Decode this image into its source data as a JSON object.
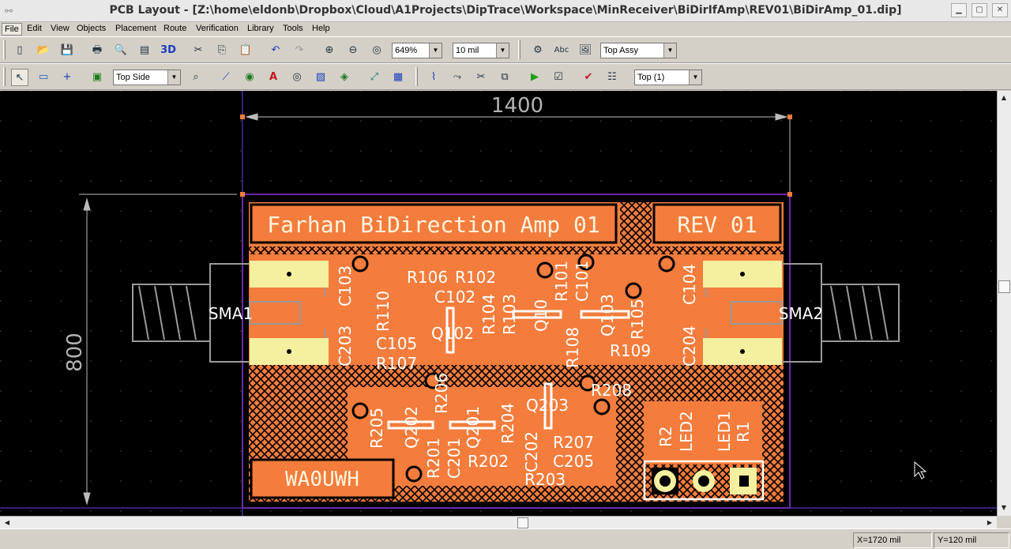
{
  "window": {
    "title": "PCB Layout - [Z:\\home\\eldonb\\Dropbox\\Cloud\\A1Projects\\DipTrace\\Workspace\\MinReceiver\\BiDirIfAmp\\REV01\\BiDirAmp_01.dip]",
    "buttons": [
      "▁",
      "▢",
      "✕"
    ]
  },
  "menu": [
    {
      "label": "File"
    },
    {
      "label": "Edit"
    },
    {
      "label": "View"
    },
    {
      "label": "Objects"
    },
    {
      "label": "Placement"
    },
    {
      "label": "Route"
    },
    {
      "label": "Verification"
    },
    {
      "label": "Library"
    },
    {
      "label": "Tools"
    },
    {
      "label": "Help"
    }
  ],
  "toolbar1": {
    "zoom": "649%",
    "grid": "10 mil",
    "view_mode": "Top Assy",
    "icons": [
      "new-icon",
      "open-icon",
      "save-icon",
      "print-icon",
      "print-preview-icon",
      "report-icon",
      "3d-view-icon",
      "cut-icon",
      "copy-icon",
      "paste-icon",
      "undo-icon",
      "redo-icon",
      "zoom-in-icon",
      "zoom-out-icon",
      "zoom-fit-icon",
      "layer-setup-icon",
      "spell-icon",
      "image-icon"
    ],
    "label_3d": "3D",
    "label_abc": "Abc"
  },
  "toolbar2": {
    "side": "Top Side",
    "layer": "Top (1)",
    "icons": [
      "select-icon",
      "ruler-icon",
      "origin-icon",
      "component-icon",
      "find-icon",
      "route-icon",
      "via-icon",
      "text-icon",
      "pad-icon",
      "copper-pour-icon",
      "shape-icon",
      "dimension-icon",
      "table-icon",
      "trace-icon",
      "auto-route-icon",
      "cut-trace-icon",
      "clone-icon",
      "run-icon",
      "check-icon",
      "drc-icon",
      "drc-setup-icon"
    ]
  },
  "pcb": {
    "dimension_h": "1400",
    "dimension_v": "800",
    "board_title": "Farhan BiDirection Amp 01",
    "revision": "REV 01",
    "callsign": "WA0UWH",
    "connectors": [
      "SMA1",
      "SMA2"
    ],
    "designators": [
      "R106",
      "R102",
      "C102",
      "R101",
      "C101",
      "R110",
      "R104",
      "R103",
      "Q10",
      "Q103",
      "R105",
      "C103",
      "C104",
      "C203",
      "C204",
      "C105",
      "Q102",
      "R108",
      "R109",
      "R107",
      "R206",
      "R208",
      "R205",
      "Q202",
      "Q201",
      "R204",
      "Q203",
      "R207",
      "R201",
      "C201",
      "R202",
      "C202",
      "C205",
      "R203",
      "R2",
      "LED2",
      "LED1",
      "R1"
    ],
    "colors": {
      "background": "#000000",
      "copper": "#f47c3c",
      "silk": "#ffffff",
      "pad": "#f5f0a0",
      "board_edge": "#6a2ab0",
      "dimension": "#bcbcbc"
    }
  },
  "status": {
    "x": "X=1720 mil",
    "y": "Y=120 mil"
  }
}
